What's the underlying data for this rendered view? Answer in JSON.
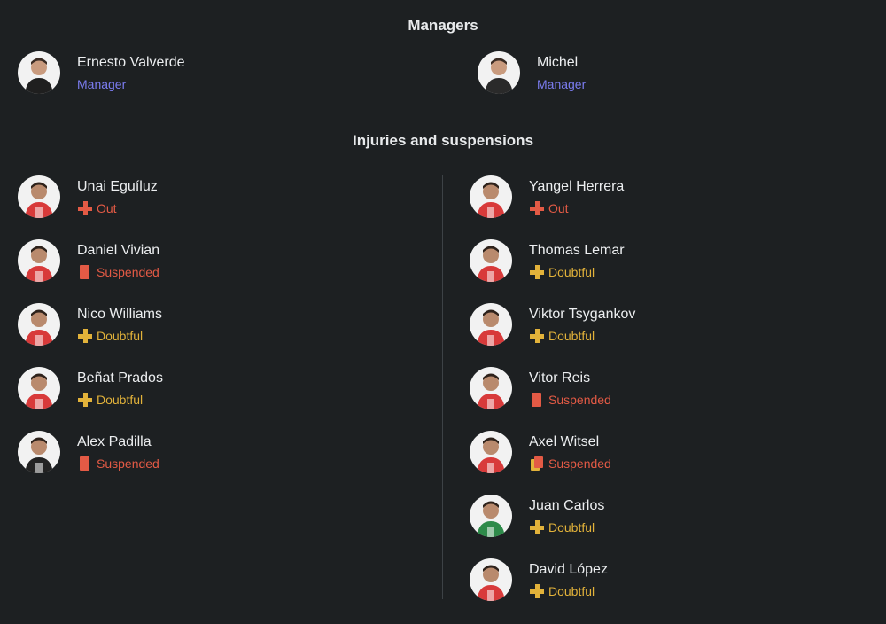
{
  "colors": {
    "background": "#1d2022",
    "role": "#7b7cf0",
    "out": "#e35a45",
    "doubtful": "#e2b23a",
    "suspended": "#e35a45"
  },
  "managers": {
    "title": "Managers",
    "items": [
      {
        "name": "Ernesto Valverde",
        "role": "Manager",
        "shirt": "#1f1f1f"
      },
      {
        "name": "Michel",
        "role": "Manager",
        "shirt": "#2a2a2a"
      }
    ]
  },
  "injuries": {
    "title": "Injuries and suspensions",
    "left": [
      {
        "name": "Unai Eguíluz",
        "status": "Out",
        "type": "out",
        "shirt": "#d83a3a"
      },
      {
        "name": "Daniel Vivian",
        "status": "Suspended",
        "type": "suspended",
        "shirt": "#d83a3a"
      },
      {
        "name": "Nico Williams",
        "status": "Doubtful",
        "type": "doubtful",
        "shirt": "#d83a3a"
      },
      {
        "name": "Beñat Prados",
        "status": "Doubtful",
        "type": "doubtful",
        "shirt": "#d83a3a"
      },
      {
        "name": "Alex Padilla",
        "status": "Suspended",
        "type": "suspended",
        "shirt": "#222222"
      }
    ],
    "right": [
      {
        "name": "Yangel Herrera",
        "status": "Out",
        "type": "out",
        "shirt": "#d83a3a"
      },
      {
        "name": "Thomas Lemar",
        "status": "Doubtful",
        "type": "doubtful",
        "shirt": "#d83a3a"
      },
      {
        "name": "Viktor Tsygankov",
        "status": "Doubtful",
        "type": "doubtful",
        "shirt": "#d83a3a"
      },
      {
        "name": "Vitor Reis",
        "status": "Suspended",
        "type": "suspended",
        "shirt": "#d83a3a"
      },
      {
        "name": "Axel Witsel",
        "status": "Suspended",
        "type": "second-yellow",
        "shirt": "#d83a3a"
      },
      {
        "name": "Juan Carlos",
        "status": "Doubtful",
        "type": "doubtful",
        "shirt": "#2e8b4a"
      },
      {
        "name": "David López",
        "status": "Doubtful",
        "type": "doubtful",
        "shirt": "#d83a3a"
      }
    ]
  }
}
